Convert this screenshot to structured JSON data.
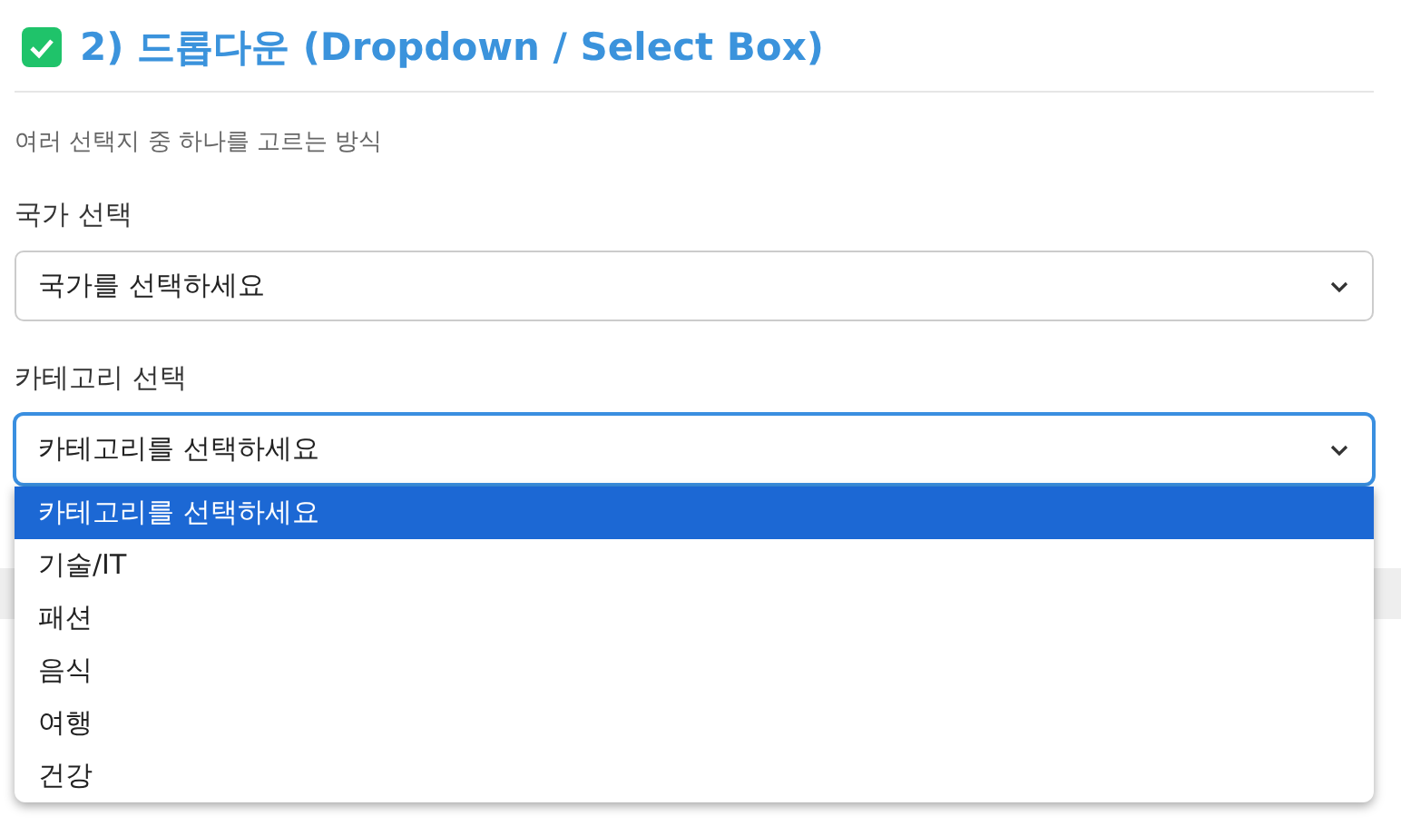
{
  "section": {
    "title": "2) 드롭다운 (Dropdown / Select Box)",
    "checked": true,
    "description": "여러 선택지 중 하나를 고르는 방식"
  },
  "fields": [
    {
      "label": "국가 선택",
      "value": "국가를 선택하세요",
      "focused": false
    },
    {
      "label": "카테고리 선택",
      "value": "카테고리를 선택하세요",
      "focused": true,
      "expanded": true,
      "options": [
        {
          "label": "카테고리를 선택하세요",
          "selected": true
        },
        {
          "label": "기술/IT",
          "selected": false
        },
        {
          "label": "패션",
          "selected": false
        },
        {
          "label": "음식",
          "selected": false
        },
        {
          "label": "여행",
          "selected": false
        },
        {
          "label": "건강",
          "selected": false
        }
      ]
    }
  ]
}
